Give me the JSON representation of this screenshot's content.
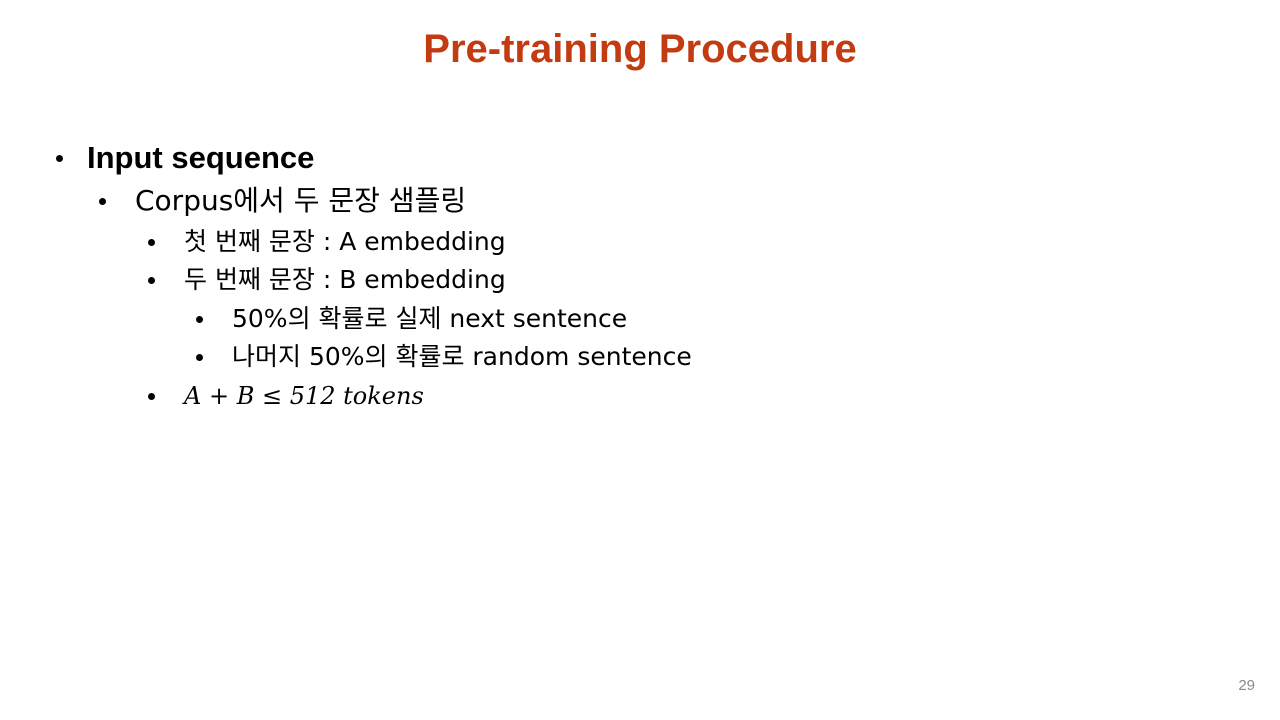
{
  "slide": {
    "title": "Pre-training Procedure",
    "page_number": "29"
  },
  "bullets": {
    "level1": "Input sequence",
    "level2": "Corpus에서 두 문장 샘플링",
    "first_sentence": "첫 번째 문장 : A embedding",
    "second_sentence": "두 번째 문장 : B embedding",
    "next_sentence": "50%의 확률로 실제 next sentence",
    "random_sentence": "나머지 50%의 확률로 random sentence",
    "length_constraint": "A + B ≤ 512 tokens"
  },
  "colors": {
    "title": "#c33b10",
    "text": "#000000",
    "page_number": "#8a8a8a"
  }
}
